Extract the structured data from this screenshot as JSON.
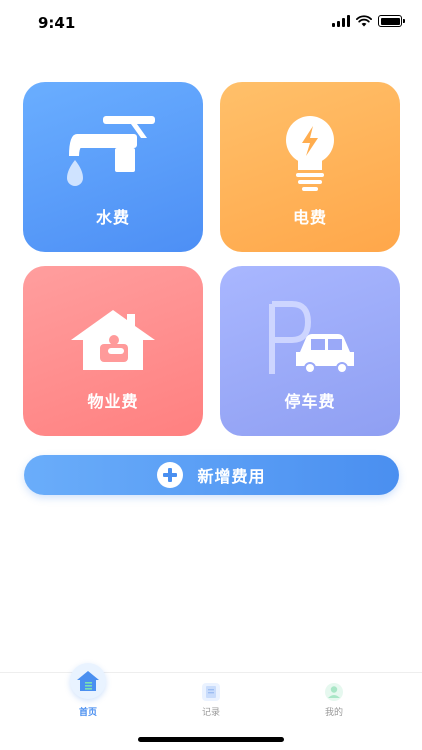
{
  "status_bar": {
    "time": "9:41",
    "icons": [
      "signal-icon",
      "wifi-icon",
      "battery-icon"
    ]
  },
  "cards": {
    "water": {
      "label": "水费",
      "icon": "faucet-icon",
      "color": "#5a9cfa"
    },
    "electricity": {
      "label": "电费",
      "icon": "lightbulb-icon",
      "color": "#ffb35a"
    },
    "property": {
      "label": "物业费",
      "icon": "house-icon",
      "color": "#ff8f8f"
    },
    "parking": {
      "label": "停车费",
      "icon": "parking-car-icon",
      "color": "#9aa9f8"
    }
  },
  "add_button": {
    "label": "新增费用",
    "icon": "plus-circle-icon"
  },
  "tab_bar": {
    "tabs": [
      {
        "label": "首页",
        "icon": "home-icon",
        "active": true
      },
      {
        "label": "记录",
        "icon": "document-icon",
        "active": false
      },
      {
        "label": "我的",
        "icon": "user-icon",
        "active": false
      }
    ],
    "active_color": "#4a8ff0",
    "inactive_color": "#999999"
  }
}
